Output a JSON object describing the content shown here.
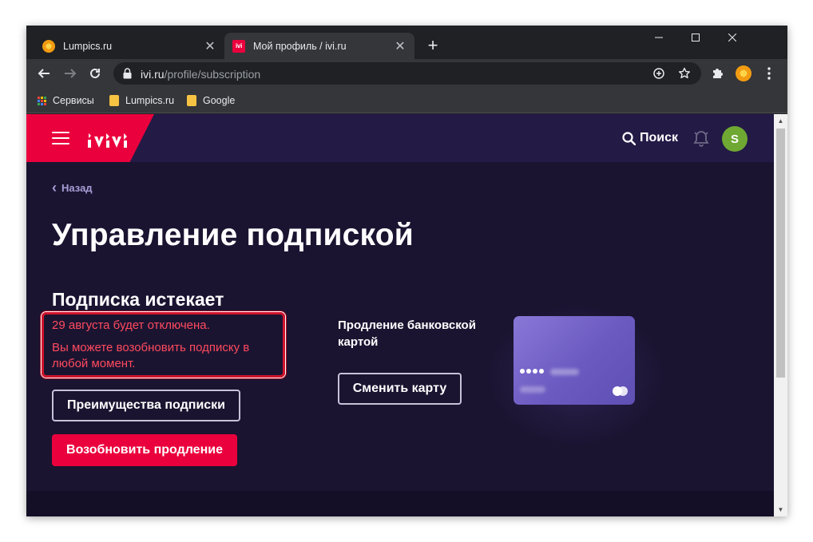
{
  "browser": {
    "tabs": [
      {
        "title": "Lumpics.ru",
        "favicon": "orange-icon"
      },
      {
        "title": "Мой профиль / ivi.ru",
        "favicon": "ivi-icon",
        "favicon_text": "ivi"
      }
    ],
    "url_host": "ivi.ru",
    "url_path": "/profile/subscription",
    "bookmarks": [
      "Сервисы",
      "Lumpics.ru",
      "Google"
    ]
  },
  "site": {
    "search_label": "Поиск",
    "avatar_letter": "S",
    "back_label": "Назад",
    "page_title": "Управление подпиской",
    "subscription": {
      "heading": "Подписка истекает",
      "notice_line1": "29 августа будет отключена.",
      "notice_line2": "Вы можете возобновить подписку в любой момент.",
      "benefits_button": "Преимущества подписки",
      "renew_button": "Возобновить продление"
    },
    "payment": {
      "label": "Продление банковской картой",
      "change_card_button": "Сменить карту"
    }
  },
  "colors": {
    "brand_red": "#ea003d",
    "page_bg": "#1b1431",
    "header_bg": "#231a46",
    "notice_text": "#ff4a5e",
    "highlight_border": "#d0142c"
  }
}
